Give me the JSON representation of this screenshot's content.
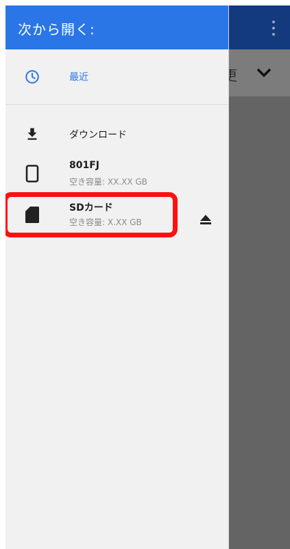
{
  "drawer": {
    "title": "次から開く:",
    "recent_label": "最近",
    "items": [
      {
        "label": "ダウンロード",
        "icon": "download-icon"
      },
      {
        "label": "801FJ",
        "sub": "空き容量: XX.XX GB",
        "icon": "phone-icon"
      },
      {
        "label": "SDカード",
        "sub": "空き容量: X.XX GB",
        "icon": "sd-card-icon",
        "action_icon": "eject-icon"
      }
    ]
  },
  "background": {
    "sort_text": "更"
  },
  "colors": {
    "header": "#2a76e6",
    "accent": "#2a76e6",
    "highlight": "#ff1010",
    "background_appbar": "#123a7c"
  }
}
